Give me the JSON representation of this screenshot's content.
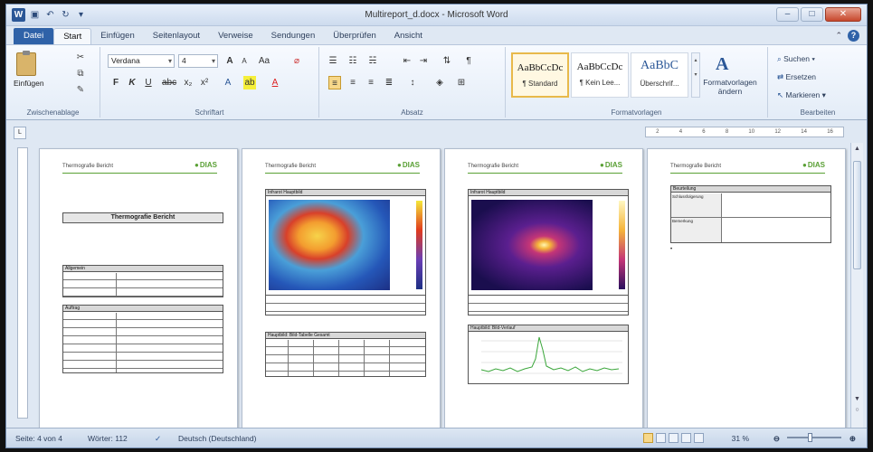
{
  "window": {
    "title": "Multireport_d.docx - Microsoft Word"
  },
  "tabs": [
    "Datei",
    "Start",
    "Einfügen",
    "Seitenlayout",
    "Verweise",
    "Sendungen",
    "Überprüfen",
    "Ansicht"
  ],
  "ribbon": {
    "clipboard": {
      "paste": "Einfügen",
      "label": "Zwischenablage"
    },
    "font": {
      "name": "Verdana",
      "size": "4",
      "label": "Schriftart"
    },
    "paragraph": {
      "label": "Absatz"
    },
    "styles": {
      "label": "Formatvorlagen",
      "items": [
        {
          "preview": "AaBbCcDc",
          "name": "¶ Standard"
        },
        {
          "preview": "AaBbCcDc",
          "name": "¶ Kein Lee..."
        },
        {
          "preview": "AaBbC",
          "name": "Überschrif..."
        }
      ],
      "change": "Formatvorlagen ändern"
    },
    "editing": {
      "search": "Suchen",
      "replace": "Ersetzen",
      "select": "Markieren",
      "label": "Bearbeiten"
    }
  },
  "ruler_ticks": [
    "2",
    "4",
    "6",
    "8",
    "10",
    "12",
    "14",
    "16"
  ],
  "pages": [
    {
      "header": "Thermografie Bericht",
      "logo": "DIAS",
      "title": "Thermografie Bericht",
      "table1_header": "Allgemein",
      "table2_header": "Auftrag"
    },
    {
      "header": "Thermografie Bericht",
      "logo": "DIAS",
      "image_header": "Infrarot Hauptbild",
      "table_header": "Hauptbild: Bild-Tabelle Gesamt"
    },
    {
      "header": "Thermografie Bericht",
      "logo": "DIAS",
      "image_header": "Infrarot Hauptbild",
      "chart_header": "Hauptbild: Bild-Verlauf"
    },
    {
      "header": "Thermografie Bericht",
      "logo": "DIAS",
      "table_header": "Beurteilung",
      "row1": "Schlussfolgerung",
      "row2": "Bemerkung"
    }
  ],
  "status": {
    "page": "Seite: 4 von 4",
    "words": "Wörter: 112",
    "language": "Deutsch (Deutschland)",
    "zoom": "31 %"
  },
  "colors": {
    "accent": "#2b5797",
    "logo_green": "#5aa035",
    "file_tab": "#2f62a8"
  }
}
